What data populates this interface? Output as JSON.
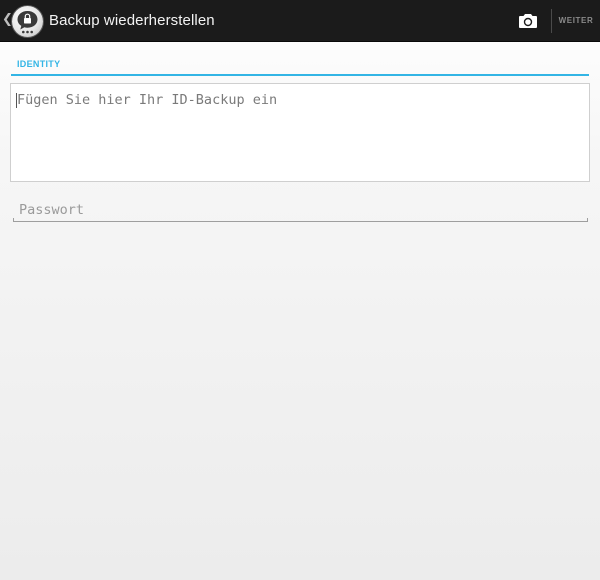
{
  "action_bar": {
    "title": "Backup wiederherstellen",
    "back_icon": "chevron-left-icon",
    "logo_icon": "threema-lock-bubble-icon",
    "camera_icon": "camera-icon",
    "next_label": "WEITER"
  },
  "form": {
    "section_label": "IDENTITY",
    "id_backup_placeholder": "Fügen Sie hier Ihr ID-Backup ein",
    "id_backup_value": "",
    "password_placeholder": "Passwort",
    "password_value": ""
  },
  "colors": {
    "accent": "#33b5e5",
    "action_bar": "#1b1b1b",
    "action_bar_text": "#f2f2f2",
    "disabled_text": "#8a8a8a"
  }
}
